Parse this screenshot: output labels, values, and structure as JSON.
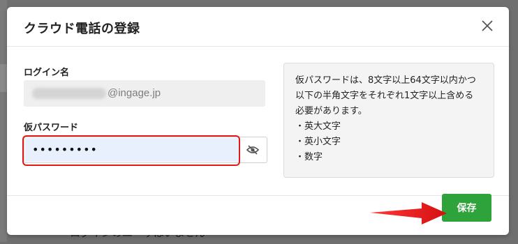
{
  "background": {
    "partial_text": "ログインのユーザはいません"
  },
  "modal": {
    "title": "クラウド電話の登録",
    "close_icon": "close-icon"
  },
  "form": {
    "login_label": "ログイン名",
    "login_domain": "@ingage.jp",
    "password_label": "仮パスワード",
    "password_value": "•••••••••",
    "eye_icon": "eye-off-icon"
  },
  "info": {
    "text": "仮パスワードは、8文字以上64文字以内かつ以下の半角文字をそれぞれ1文字以上含める必要があります。",
    "items": [
      "・英大文字",
      "・英小文字",
      "・数字"
    ]
  },
  "footer": {
    "save_label": "保存"
  },
  "colors": {
    "accent_green": "#2ea33c",
    "highlight_red": "#e01b1b",
    "autofill_blue": "#e8f0fe"
  }
}
